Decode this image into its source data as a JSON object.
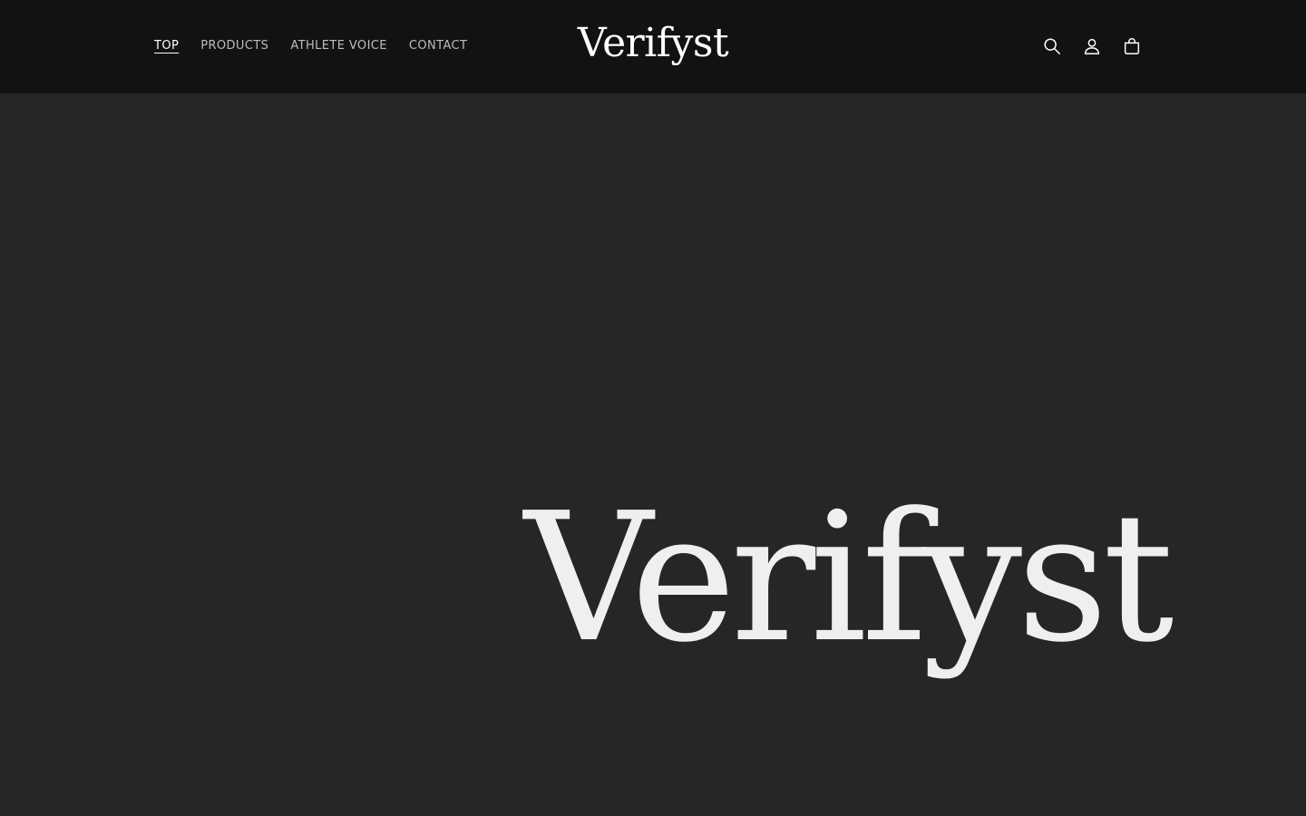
{
  "header": {
    "nav": [
      {
        "label": "TOP",
        "active": true
      },
      {
        "label": "PRODUCTS",
        "active": false
      },
      {
        "label": "ATHLETE VOICE",
        "active": false
      },
      {
        "label": "CONTACT",
        "active": false
      }
    ],
    "logo": "Verifyst",
    "icons": [
      "search-icon",
      "account-icon",
      "cart-icon"
    ]
  },
  "hero": {
    "wordmark": "Verifyst"
  },
  "colors": {
    "header_bg": "#121212",
    "hero_bg": "#262626",
    "text": "#ffffff",
    "nav_text": "#bdbdbd"
  }
}
